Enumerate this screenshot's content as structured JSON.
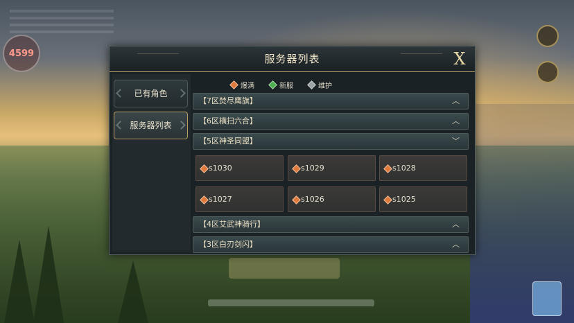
{
  "hud": {
    "level": "4599"
  },
  "dialog": {
    "title": "服务器列表",
    "close_label": "X"
  },
  "sidebar": {
    "tabs": [
      {
        "label": "已有角色",
        "active": false
      },
      {
        "label": "服务器列表",
        "active": true
      }
    ]
  },
  "legend": [
    {
      "label": "爆满",
      "color": "#e07a3a"
    },
    {
      "label": "新服",
      "color": "#4caf50"
    },
    {
      "label": "维护",
      "color": "#9aa4a6"
    }
  ],
  "zones": [
    {
      "label": "【7区焚尽鹰旗】",
      "chevron": "︿"
    },
    {
      "label": "【6区横扫六合】",
      "chevron": "︿"
    },
    {
      "label": "【5区神圣同盟】",
      "chevron": "﹀"
    },
    {
      "label": "【4区艾武神骑行】",
      "chevron": "︿"
    },
    {
      "label": "【3区白刃剑闪】",
      "chevron": "︿"
    }
  ],
  "servers": [
    {
      "name": "s1030",
      "status_color": "#e07a3a"
    },
    {
      "name": "s1029",
      "status_color": "#e07a3a"
    },
    {
      "name": "s1028",
      "status_color": "#e07a3a"
    },
    {
      "name": "s1027",
      "status_color": "#e07a3a"
    },
    {
      "name": "s1026",
      "status_color": "#e07a3a"
    },
    {
      "name": "s1025",
      "status_color": "#e07a3a"
    }
  ]
}
